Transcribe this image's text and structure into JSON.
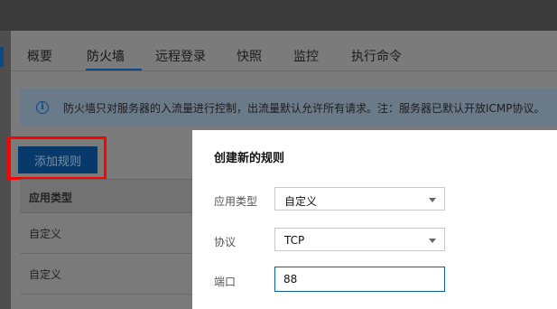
{
  "tabs": [
    "概要",
    "防火墙",
    "远程登录",
    "快照",
    "监控",
    "执行命令"
  ],
  "active_tab": "防火墙",
  "notice": {
    "icon": "info-icon",
    "text": "防火墙只对服务器的入流量进行控制，出流量默认允许所有请求。注：服务器已默认开放ICMP协议。"
  },
  "add_rule_button": "添加规则",
  "table": {
    "header": "应用类型",
    "rows": [
      "自定义",
      "自定义"
    ]
  },
  "dialog": {
    "title": "创建新的规则",
    "app_type": {
      "label": "应用类型",
      "value": "自定义"
    },
    "protocol": {
      "label": "协议",
      "value": "TCP"
    },
    "port": {
      "label": "端口",
      "value": "88"
    }
  },
  "colors": {
    "accent": "#0a4a86",
    "highlight": "#ff0000",
    "overlay": "#6d6d6d",
    "focus_border": "#0a5eb0"
  }
}
